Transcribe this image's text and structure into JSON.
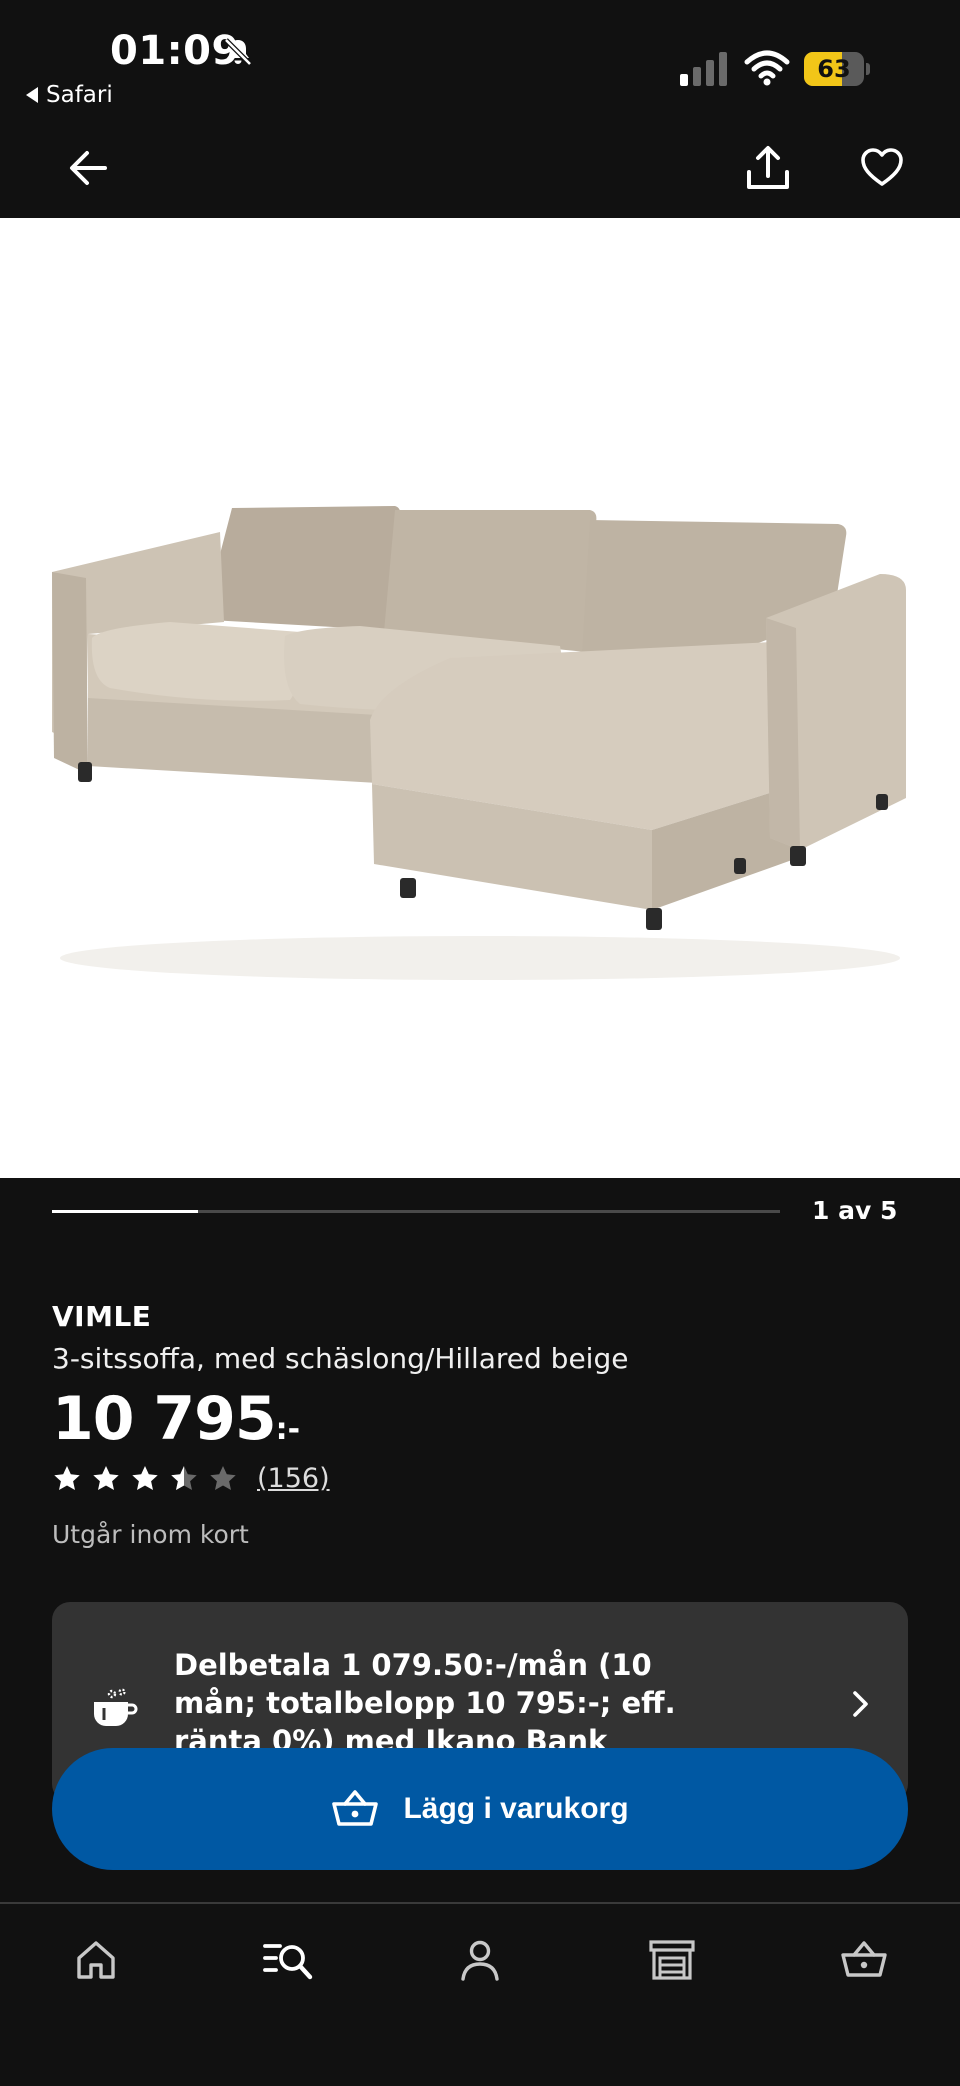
{
  "status_bar": {
    "time": "01:09",
    "back_app": "Safari",
    "battery_percent": 63,
    "battery_label": "63",
    "icons": [
      "bell-slash-icon",
      "signal-icon",
      "wifi-icon",
      "battery-icon"
    ]
  },
  "header": {
    "icons": [
      "arrow-left-icon",
      "share-icon",
      "heart-icon"
    ]
  },
  "gallery": {
    "current": 1,
    "total": 5,
    "pager_label": "1 av 5"
  },
  "product": {
    "brand": "VIMLE",
    "description": "3-sitssoffa, med schäslong/Hillared beige",
    "price": "10 795",
    "price_suffix": ":-",
    "rating": 3.5,
    "rating_max": 5,
    "review_count": "(156)",
    "availability": "Utgår inom kort"
  },
  "finance": {
    "text": "Delbetala 1 079.50:-/mån (10 mån; totalbelopp 10 795:-; eff. ränta 0%) med Ikano Bank",
    "icon": "piggy-bank-icon"
  },
  "cart_button": {
    "label": "Lägg i varukorg",
    "icon": "shopping-basket-icon"
  },
  "bottom_nav": {
    "items": [
      "home-icon",
      "search-list-icon",
      "profile-icon",
      "store-icon",
      "basket-icon"
    ],
    "active": "search-list-icon"
  },
  "colors": {
    "background": "#111111",
    "accent_blue": "#0058a3",
    "battery_yellow": "#f2c618",
    "card": "#333333"
  }
}
